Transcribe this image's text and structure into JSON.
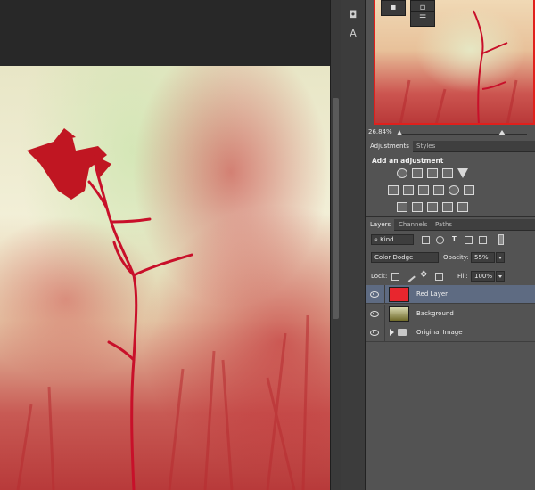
{
  "navigator": {
    "zoom": "26.84%"
  },
  "adjustments_panel": {
    "tabs": [
      {
        "label": "Adjustments",
        "active": true
      },
      {
        "label": "Styles",
        "active": false
      }
    ],
    "title": "Add an adjustment"
  },
  "layers_panel": {
    "tabs": [
      {
        "label": "Layers",
        "active": true
      },
      {
        "label": "Channels",
        "active": false
      },
      {
        "label": "Paths",
        "active": false
      }
    ],
    "filter_kind": "Kind",
    "blend_mode": "Color Dodge",
    "opacity_label": "Opacity:",
    "opacity_value": "55%",
    "lock_label": "Lock:",
    "fill_label": "Fill:",
    "fill_value": "100%",
    "layers": [
      {
        "name": "Red Layer",
        "selected": true,
        "thumb_color": "#e8262e"
      },
      {
        "name": "Background",
        "selected": false
      },
      {
        "name": "Original Image",
        "selected": false,
        "type": "group"
      }
    ]
  },
  "colors": {
    "accent_selected": "#5e6b82",
    "nav_frame": "#e0201c"
  }
}
